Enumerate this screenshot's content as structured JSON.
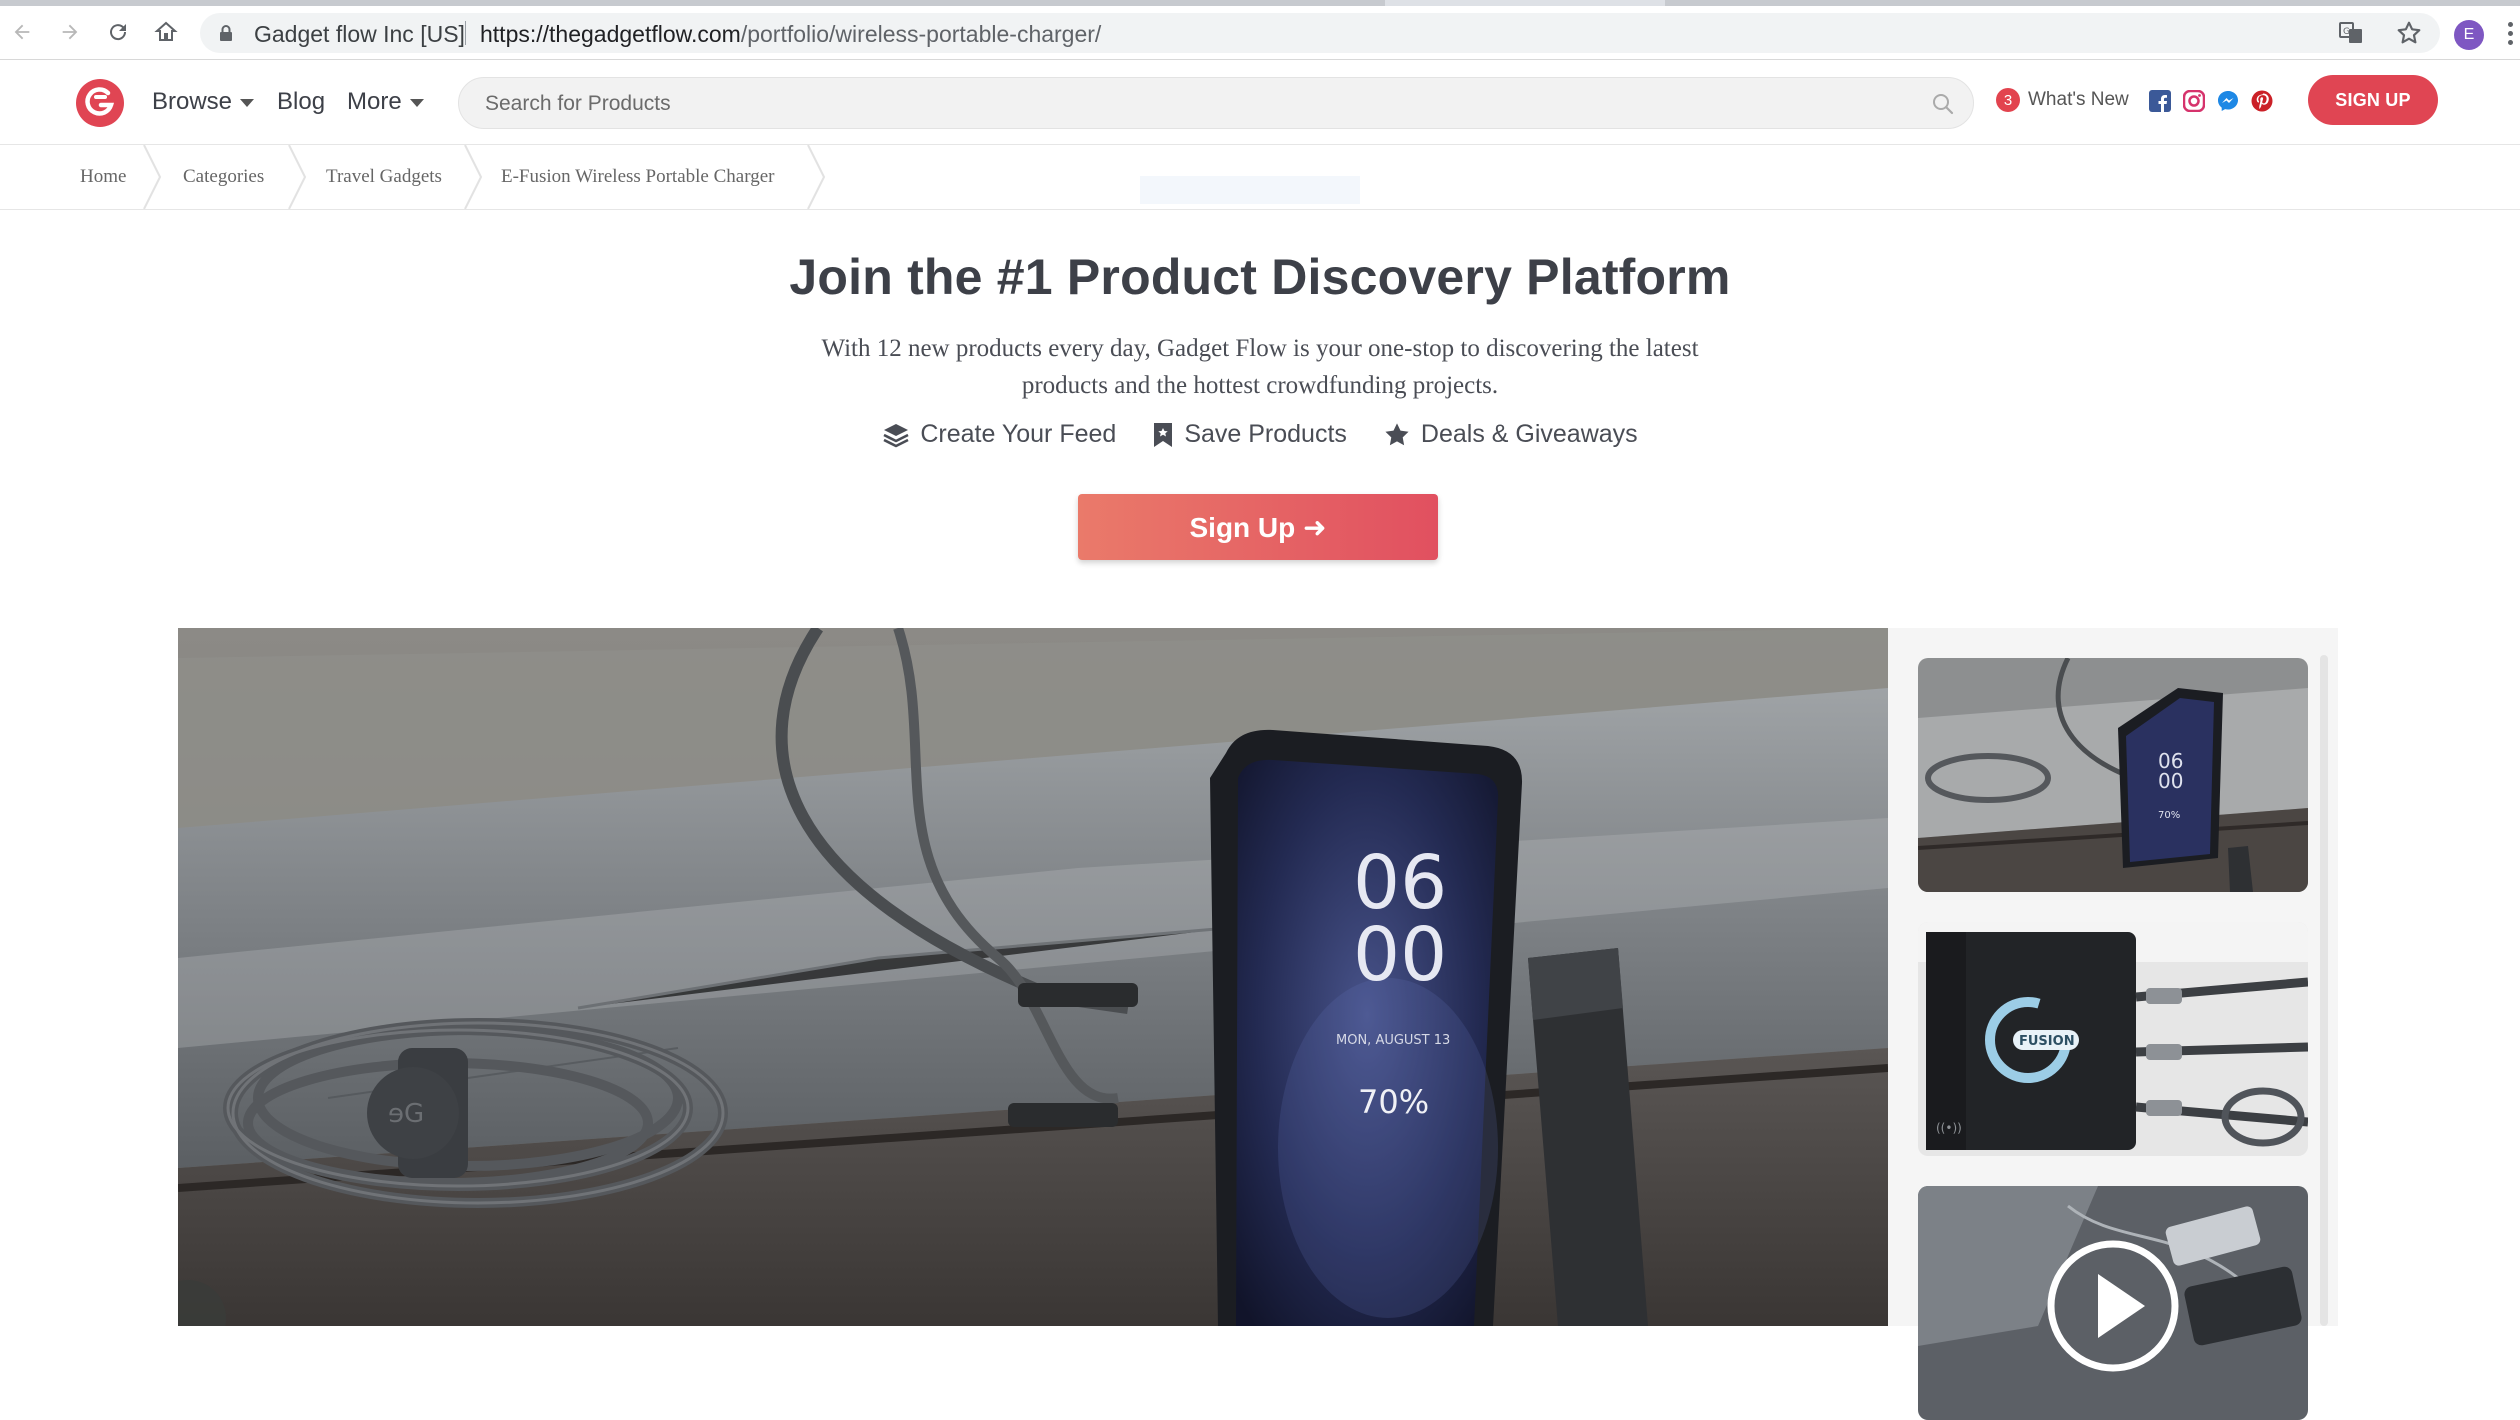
{
  "browser": {
    "site_identity": "Gadget flow Inc [US]",
    "url_host": "https://thegadgetflow.com",
    "url_path": "/portfolio/wireless-portable-charger/",
    "profile_initial": "E"
  },
  "header": {
    "nav": {
      "browse": "Browse",
      "blog": "Blog",
      "more": "More"
    },
    "search_placeholder": "Search for Products",
    "whats_new_count": "3",
    "whats_new_label": "What's New",
    "signup_label": "SIGN UP",
    "social_icons": [
      "facebook-icon",
      "instagram-icon",
      "messenger-icon",
      "pinterest-icon"
    ]
  },
  "breadcrumb": [
    "Home",
    "Categories",
    "Travel Gadgets",
    "E-Fusion Wireless Portable Charger"
  ],
  "hero": {
    "title": "Join the #1 Product Discovery Platform",
    "subtitle": "With 12 new products every day, Gadget Flow is your one-stop to discovering the latest products and the hottest crowdfunding projects.",
    "features": [
      {
        "icon": "layers-icon",
        "label": "Create Your Feed"
      },
      {
        "icon": "bookmark-icon",
        "label": "Save Products"
      },
      {
        "icon": "star-icon",
        "label": "Deals & Giveaways"
      }
    ],
    "cta_label": "Sign Up ➜"
  },
  "gallery": {
    "main_phone_time_hours": "06",
    "main_phone_time_minutes": "00",
    "main_phone_date": "MON, AUGUST 13",
    "main_phone_battery": "70%",
    "thumb_phone_time_hours": "06",
    "thumb_phone_time_minutes": "00",
    "thumb_phone_battery": "70%",
    "thumb_brand": "FUSION"
  },
  "colors": {
    "brand_red": "#e04553",
    "cta_gradient_start": "#ea7a6a",
    "cta_gradient_end": "#e15060",
    "text_dark": "#3d4048"
  }
}
